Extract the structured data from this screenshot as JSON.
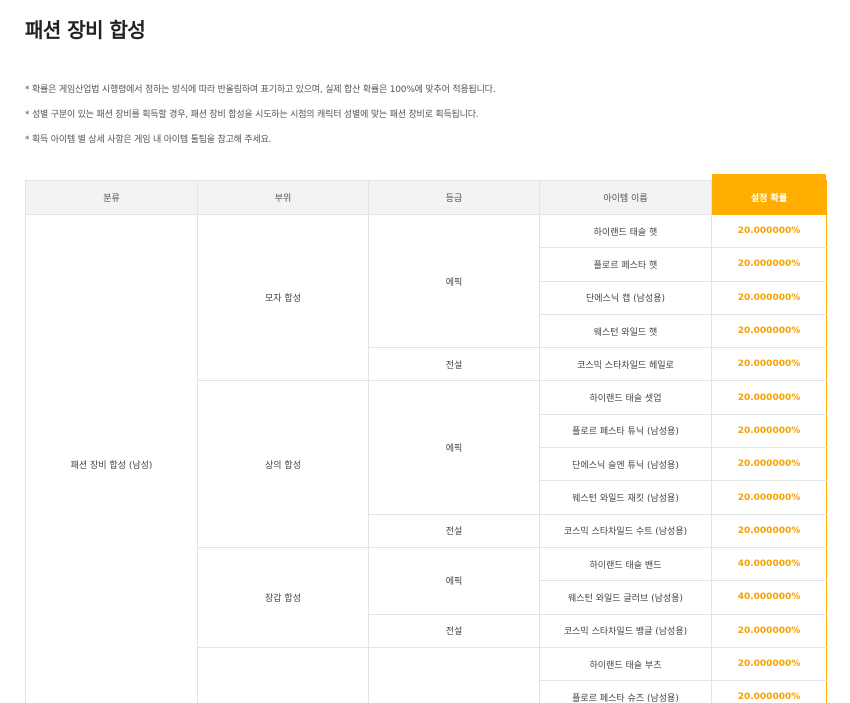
{
  "page": {
    "title": "패션 장비 합성",
    "notes": [
      "* 확률은 게임산업법 시행령에서 정하는 방식에 따라 반올림하여 표기하고 있으며, 실제 합산 확률은 100%에 맞추어 적용됩니다.",
      "* 성별 구분이 있는 패션 장비를 획득할 경우, 패션 장비 합성을 시도하는 시점의 캐릭터 성별에 맞는 패션 장비로 획득됩니다.",
      "* 획득 아이템 별 상세 사항은 게임 내 아이템 툴팁을 참고해 주세요."
    ]
  },
  "table": {
    "headers": [
      "분류",
      "부위",
      "등급",
      "아이템 이름",
      "설정 확률"
    ],
    "category": "패션 장비 합성 (남성)",
    "parts": [
      "모자 합성",
      "상의 합성",
      "장갑 합성"
    ],
    "grades": {
      "epic": "에픽",
      "legend": "전설"
    },
    "items": [
      {
        "name": "하이랜드 태슬 햇",
        "rate": "20.000000%"
      },
      {
        "name": "플로르 페스타 햇",
        "rate": "20.000000%"
      },
      {
        "name": "단에스닉 캡 (남성용)",
        "rate": "20.000000%"
      },
      {
        "name": "웨스턴 와일드 햇",
        "rate": "20.000000%"
      },
      {
        "name": "코스믹 스타차일드 헤일로",
        "rate": "20.000000%"
      },
      {
        "name": "하이랜드 태슬 셋업",
        "rate": "20.000000%"
      },
      {
        "name": "플로르 페스타 튜닉 (남성용)",
        "rate": "20.000000%"
      },
      {
        "name": "단에스닉 슬엔 튜닉 (남성용)",
        "rate": "20.000000%"
      },
      {
        "name": "웨스턴 와일드 재킷 (남성용)",
        "rate": "20.000000%"
      },
      {
        "name": "코스믹 스타차일드 수트 (남성용)",
        "rate": "20.000000%"
      },
      {
        "name": "하이랜드 태슬 밴드",
        "rate": "40.000000%"
      },
      {
        "name": "웨스턴 와일드 글러브 (남성용)",
        "rate": "40.000000%"
      },
      {
        "name": "코스믹 스타차일드 뱅글 (남성용)",
        "rate": "20.000000%"
      },
      {
        "name": "하이랜드 태슬 부츠",
        "rate": "20.000000%"
      },
      {
        "name": "플로르 페스타 슈즈 (남성용)",
        "rate": "20.000000%"
      }
    ]
  },
  "colors": {
    "accent": "#ffae00",
    "rate_text": "#f5a100",
    "header_bg": "#f3f3f3",
    "border": "#e3e3e3"
  }
}
